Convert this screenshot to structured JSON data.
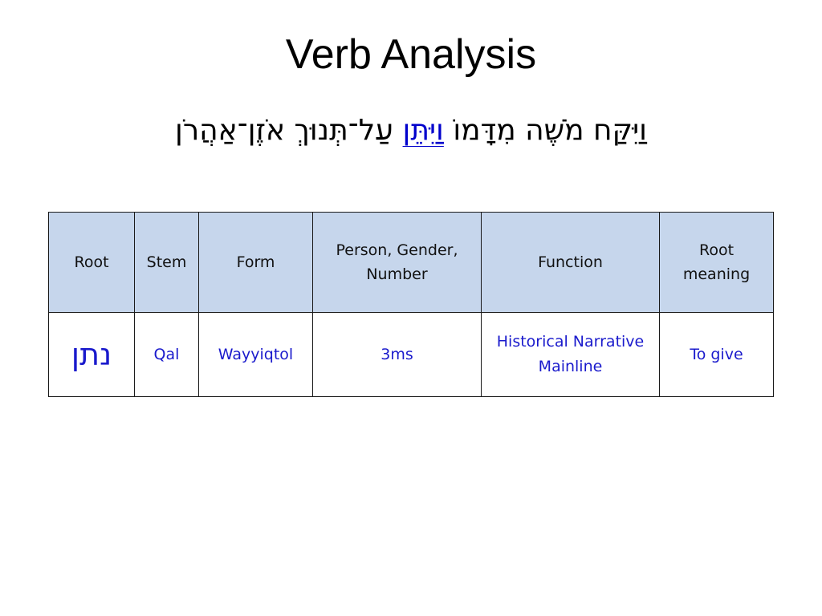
{
  "slide": {
    "title": "Verb Analysis",
    "verse": {
      "before": "וַיִּקַּח מֹשֶׁה מִדָּמוֹ",
      "highlight": "וַיִּתֵּן",
      "after": "עַל־תְּנוּךְ אֹזֶן־אַהֲרֹן"
    },
    "colors": {
      "header_bg": "#c6d6ec",
      "highlight_text": "#1a1acc"
    }
  },
  "table": {
    "headers": [
      "Root",
      "Stem",
      "Form",
      "Person, Gender, Number",
      "Function",
      "Root meaning"
    ],
    "rows": [
      [
        "נתן",
        "Qal",
        "Wayyiqtol",
        "3ms",
        "Historical Narrative Mainline",
        "To give"
      ]
    ]
  }
}
